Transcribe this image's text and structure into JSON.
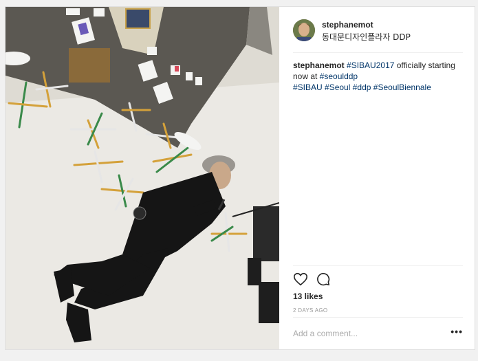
{
  "post": {
    "username": "stephanemot",
    "location": "동대문디자인플라자 DDP",
    "caption": {
      "username": "stephanemot",
      "text_1": " ",
      "tag_1": "#SIBAU2017",
      "text_2": " officially starting now at ",
      "tag_2": "#seoulddp",
      "tag_3": "#SIBAU",
      "tag_4": "#Seoul",
      "tag_5": "#ddp",
      "tag_6": "#SeoulBiennale"
    },
    "likes": "13 likes",
    "timestamp": "2 DAYS AGO",
    "comment_placeholder": "Add a comment...",
    "more_label": "•••"
  },
  "icons": [
    "heart-icon",
    "comment-icon"
  ],
  "colors": {
    "hashtag": "#003569",
    "text": "#262626",
    "muted": "#999999"
  }
}
